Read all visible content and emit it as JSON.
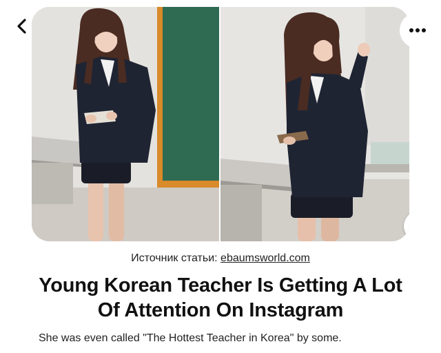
{
  "source": {
    "prefix": "Источник статьи: ",
    "link_text": "ebaumsworld.com"
  },
  "article": {
    "title": "Young Korean Teacher Is Getting A Lot Of Attention On Instagram",
    "description": "She was even called \"The Hottest Teacher in Korea\" by some."
  },
  "icons": {
    "back": "chevron-left-icon",
    "more": "more-horizontal-icon",
    "lens": "visual-search-icon"
  },
  "colors": {
    "chalkboard": "#2f6b53",
    "board_frame": "#d98a2a",
    "blazer": "#1f2433",
    "hair": "#4a2c22"
  }
}
